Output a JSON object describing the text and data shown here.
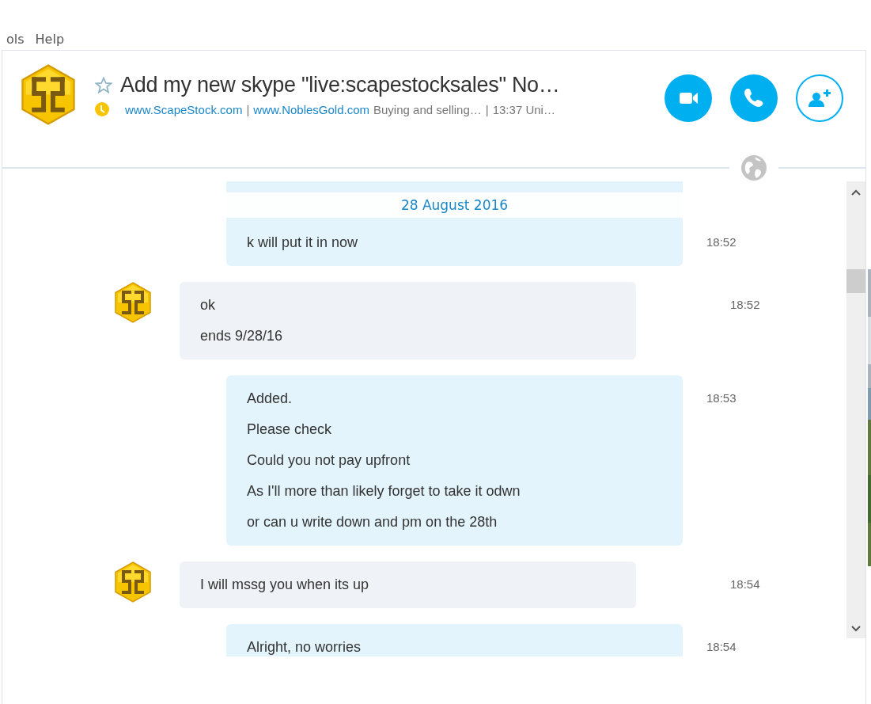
{
  "menu": [
    {
      "label": "ols"
    },
    {
      "label": "Help"
    }
  ],
  "conversation": {
    "favorite": false,
    "title": "Add my new skype \"live:scapestocksales\" No…",
    "subtitle": [
      {
        "kind": "link",
        "text": "www.ScapeStock.com"
      },
      {
        "kind": "text",
        "text": "|"
      },
      {
        "kind": "link",
        "text": "www.NoblesGold.com"
      },
      {
        "kind": "text",
        "text": "Buying and selling…"
      },
      {
        "kind": "text",
        "text": "|"
      },
      {
        "kind": "text",
        "text": "13:37 Uni…"
      }
    ]
  },
  "call_buttons": [
    {
      "kind": "video"
    },
    {
      "kind": "call"
    },
    {
      "kind": "add_contact"
    }
  ],
  "date_banner": "28 August 2016",
  "messages": [
    {
      "kind": "outgoing",
      "lines": [
        "k will put it in now"
      ],
      "time": "18:52"
    },
    {
      "kind": "incoming",
      "lines": [
        "ok",
        "ends 9/28/16"
      ],
      "time": "18:52"
    },
    {
      "kind": "outgoing",
      "lines": [
        "Added.",
        "Please check",
        "Could you not pay upfront",
        "As I'll more than likely forget to take it odwn",
        "or can u write down and pm on the 28th"
      ],
      "time": "18:53"
    },
    {
      "kind": "incoming",
      "lines": [
        "I will mssg you when its up"
      ],
      "time": "18:54"
    },
    {
      "kind": "outgoing",
      "lines": [
        "Alright, no worries"
      ],
      "time": "18:54"
    }
  ]
}
